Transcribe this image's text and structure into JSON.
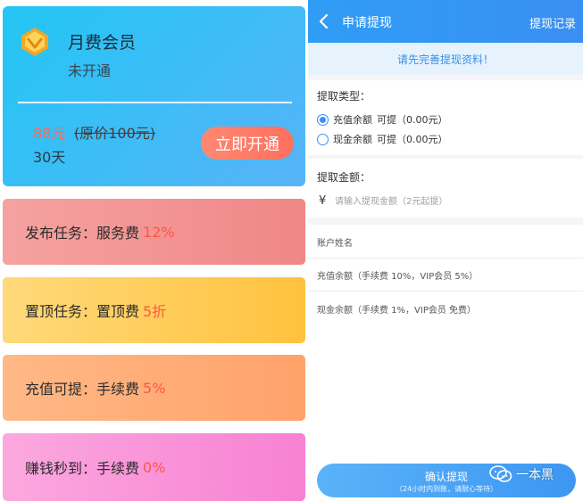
{
  "membership": {
    "title": "月费会员",
    "status": "未开通",
    "price_now": "88元",
    "price_original": "(原价100元)",
    "duration": "30天",
    "open_button": "立即开通",
    "crown_icon": "diamond-crown-icon"
  },
  "benefits": [
    {
      "label": "发布任务：服务费",
      "value": "12%"
    },
    {
      "label": "置顶任务：置顶费",
      "value": "5折"
    },
    {
      "label": "充值可提：手续费",
      "value": "5%"
    },
    {
      "label": "赚钱秒到：手续费",
      "value": "0%"
    }
  ],
  "withdraw": {
    "title": "申请提现",
    "history_link": "提现记录",
    "notice": "请先完善提现资料！",
    "type_label": "提取类型：",
    "options": [
      {
        "label": "充值余额",
        "note": "可提（0.00元）",
        "selected": true
      },
      {
        "label": "现金余额",
        "note": "可提（0.00元）",
        "selected": false
      }
    ],
    "amount_label": "提取金额：",
    "currency_symbol": "¥",
    "amount_placeholder": "请输入提现金额（2元起提）",
    "info_items": [
      "账户姓名",
      "充值余额（手续费 10%，VIP会员 5%）",
      "现金余额（手续费 1%，VIP会员 免费）"
    ],
    "confirm_button": "确认提现",
    "confirm_subtext": "（24小时内到账，请耐心等待）"
  },
  "watermark": {
    "text": "一本黑",
    "icon": "wechat-icon"
  },
  "colors": {
    "accent_blue": "#3a8ff2",
    "highlight_red": "#ff5545",
    "open_button": "#ff6f5f"
  }
}
